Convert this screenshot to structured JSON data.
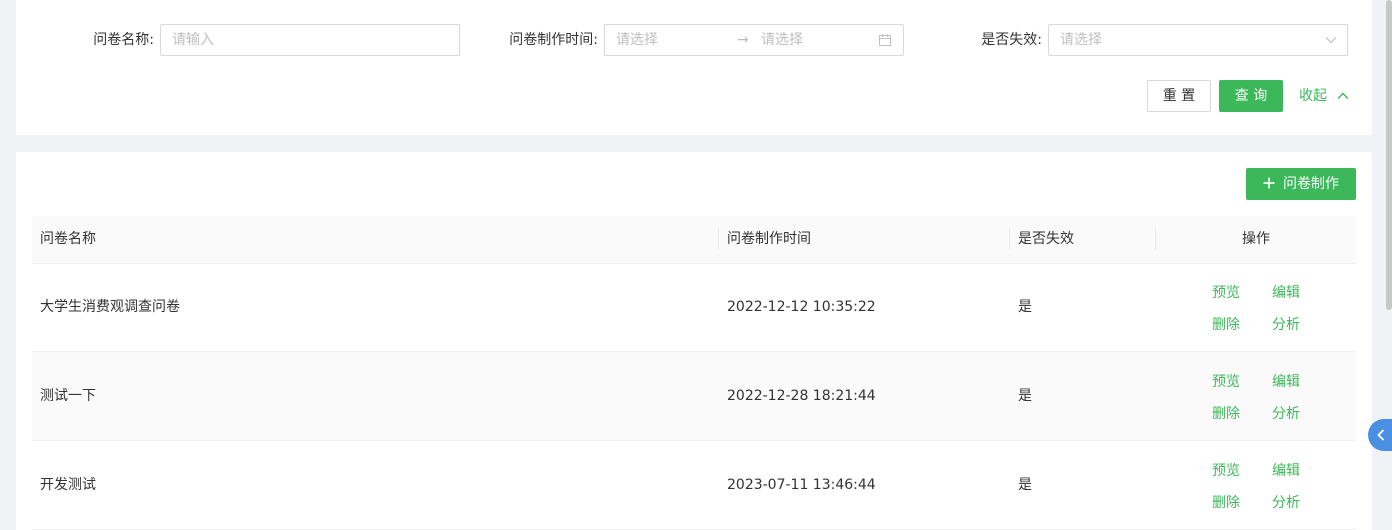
{
  "search": {
    "name_label": "问卷名称:",
    "name_placeholder": "请输入",
    "time_label": "问卷制作时间:",
    "time_start_placeholder": "请选择",
    "time_end_placeholder": "请选择",
    "invalid_label": "是否失效:",
    "invalid_placeholder": "请选择",
    "reset_label": "重 置",
    "query_label": "查 询",
    "collapse_label": "收起"
  },
  "toolbar": {
    "create_label": "问卷制作"
  },
  "table": {
    "columns": [
      "问卷名称",
      "问卷制作时间",
      "是否失效",
      "操作"
    ],
    "rows": [
      {
        "name": "大学生消费观调查问卷",
        "time": "2022-12-12 10:35:22",
        "invalid": "是"
      },
      {
        "name": "测试一下",
        "time": "2022-12-28 18:21:44",
        "invalid": "是"
      },
      {
        "name": "开发测试",
        "time": "2023-07-11 13:46:44",
        "invalid": "是"
      }
    ],
    "actions": {
      "preview": "预览",
      "edit": "编辑",
      "delete": "删除",
      "analyze": "分析"
    }
  },
  "colors": {
    "primary": "#3cb85a",
    "float_tab": "#4a90e2"
  }
}
